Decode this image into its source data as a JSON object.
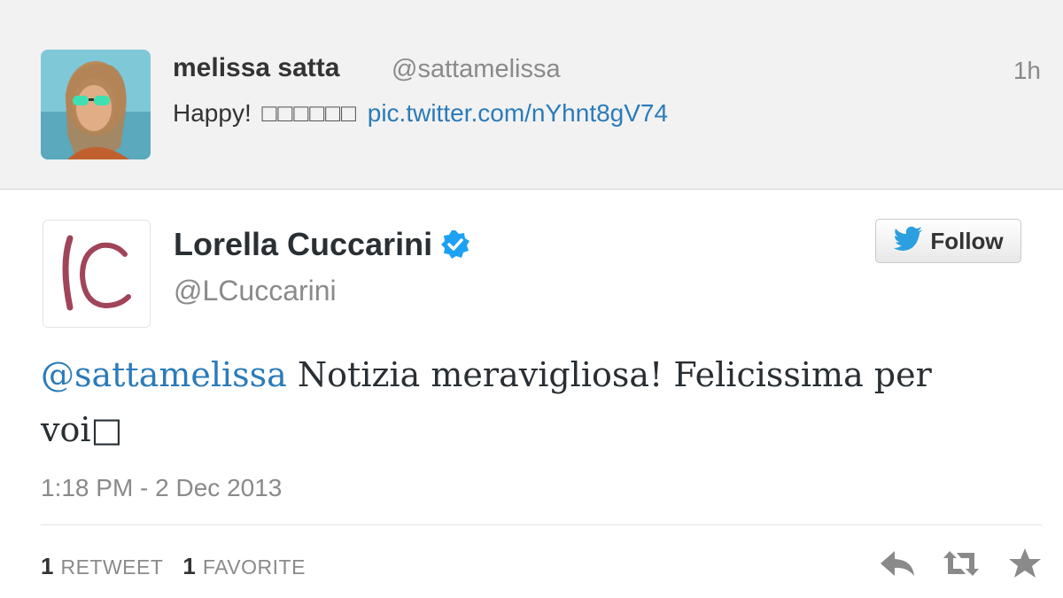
{
  "parent_tweet": {
    "name": "melissa satta",
    "handle": "@sattamelissa",
    "time": "1h",
    "text_prefix": "Happy!",
    "text_boxes": "□□□□□□",
    "link": "pic.twitter.com/nYhnt8gV74"
  },
  "main_tweet": {
    "name": "Lorella Cuccarini",
    "handle": "@LCuccarini",
    "follow_label": "Follow",
    "mention": "@sattamelissa",
    "text": " Notizia meravigliosa! Felicissima per voi□",
    "timestamp": "1:18 PM - 2 Dec 2013",
    "retweet_count": "1",
    "retweet_label": "RETWEET",
    "favorite_count": "1",
    "favorite_label": "FAVORITE"
  },
  "colors": {
    "link": "#2b7bb9",
    "verified": "#1da1f2",
    "logo": "#a0445a"
  },
  "icons": [
    "verified-icon",
    "twitter-bird-icon",
    "reply-icon",
    "retweet-icon",
    "favorite-icon"
  ]
}
